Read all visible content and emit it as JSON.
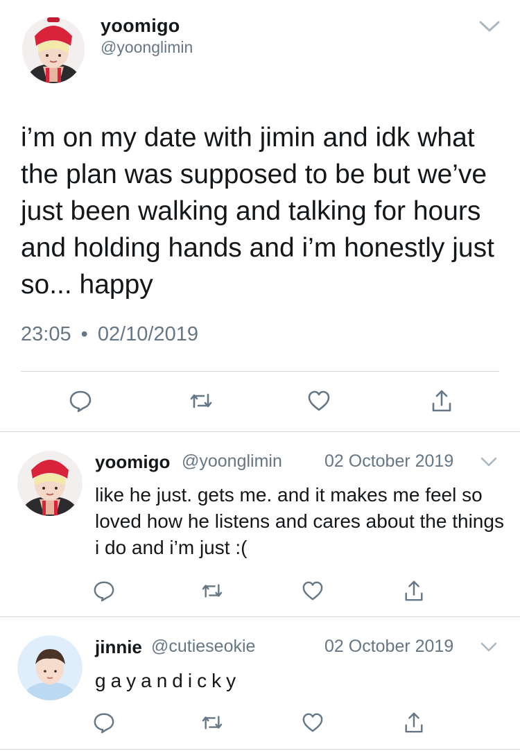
{
  "main_tweet": {
    "display_name": "yoomigo",
    "handle": "@yoonglimin",
    "text": "i’m on my date with jimin and idk what the plan was supposed to be but we’ve just been walking and talking for hours and holding hands and i’m honestly just so... happy",
    "time": "23:05",
    "separator": "•",
    "date": "02/10/2019",
    "actions": [
      "reply-icon",
      "retweet-icon",
      "like-icon",
      "share-icon"
    ]
  },
  "replies": [
    {
      "display_name": "yoomigo",
      "handle": "@yoonglimin",
      "date": "02 October 2019",
      "text": "like he just. gets me. and it makes me feel so loved how he listens and cares about the things i do and i’m just :("
    },
    {
      "display_name": "jinnie",
      "handle": "@cutieseokie",
      "date": "02 October 2019",
      "text": "gayandicky"
    }
  ],
  "colors": {
    "text": "#14171a",
    "secondary": "#657786",
    "divider": "#d4d8dc",
    "icon": "#657786",
    "beanie_red": "#d8233a"
  }
}
